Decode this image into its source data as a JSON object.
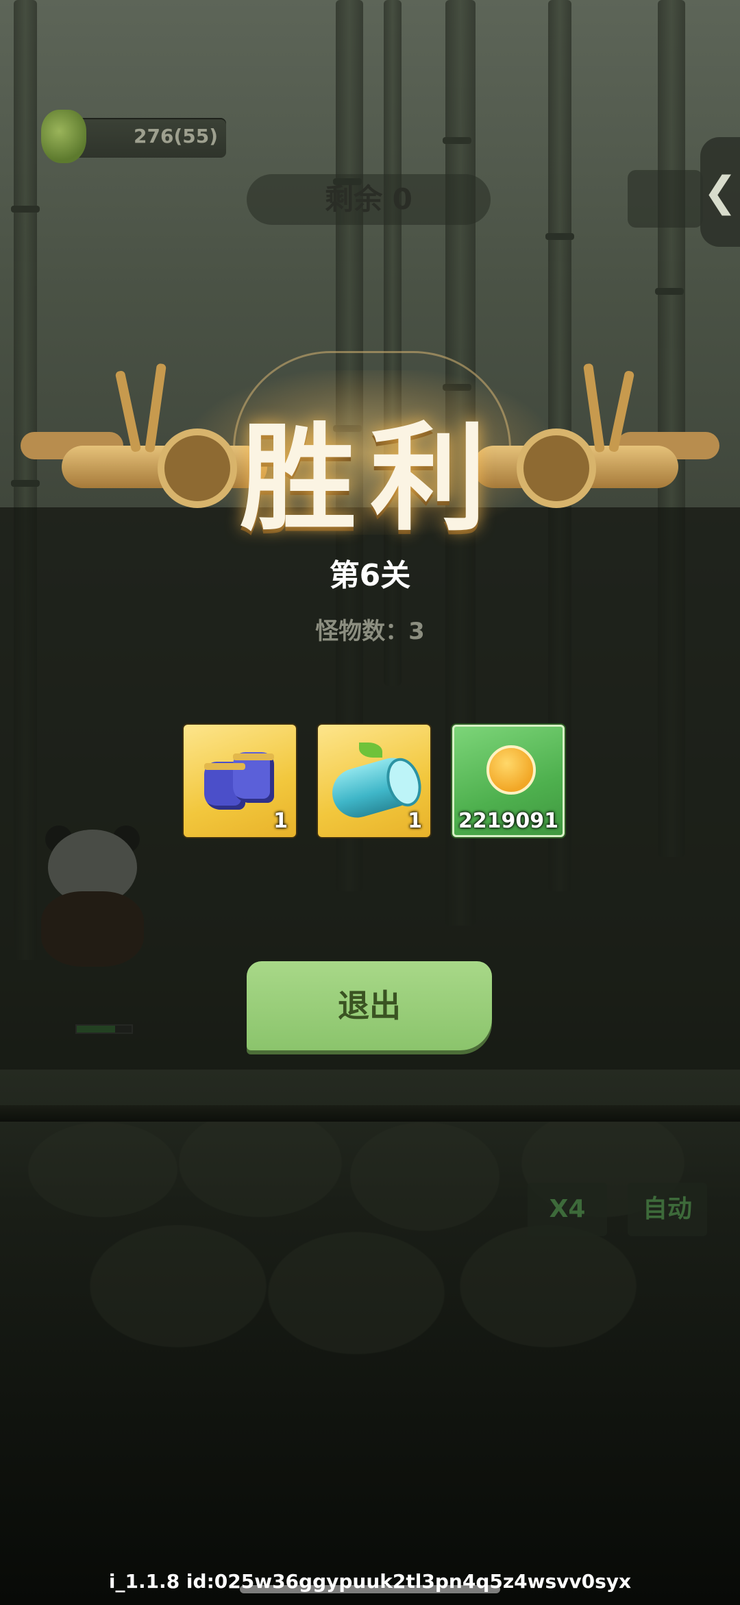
{
  "hud": {
    "resource_value": "276(55)",
    "remaining_label": "剩余 0",
    "side_arrow": "❮"
  },
  "result": {
    "title": "胜利",
    "level": "第6关",
    "monster_count": "怪物数：3",
    "rewards": [
      {
        "name": "boots",
        "count": "1"
      },
      {
        "name": "log",
        "count": "1"
      },
      {
        "name": "paw-coin",
        "count": "2219091"
      }
    ],
    "exit_label": "退出"
  },
  "controls": {
    "speed_label": "X4",
    "auto_label": "自动"
  },
  "footer": {
    "version": "i_1.1.8 id:025w36ggypuuk2tl3pn4q5z4wsvv0syx"
  },
  "colors": {
    "victory_glow": "#ffbe50",
    "exit_button": "#a8d888",
    "gold_tile": "#f2c73d",
    "green_tile": "#4eb04e"
  }
}
